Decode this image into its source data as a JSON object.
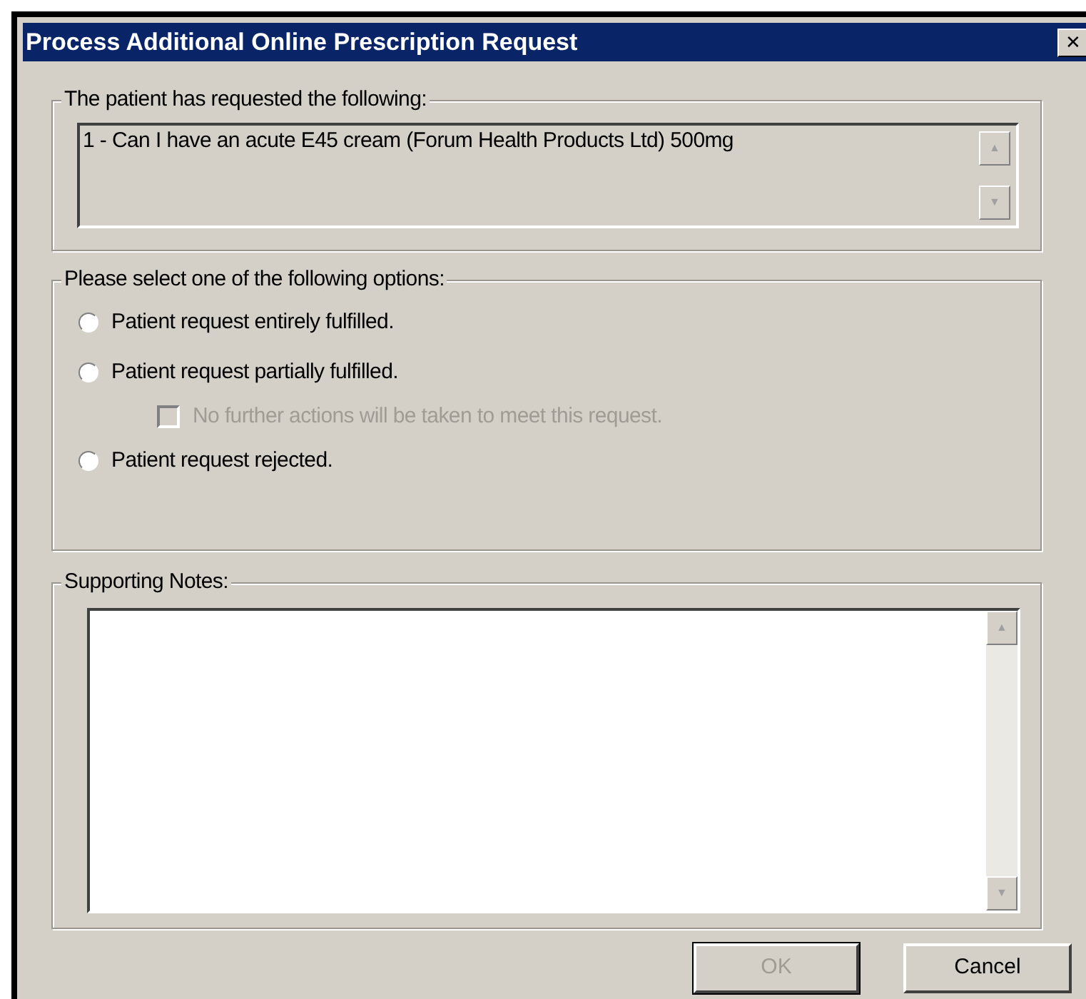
{
  "window": {
    "title": "Process Additional Online Prescription Request",
    "close": "✕"
  },
  "request_group": {
    "legend": "The patient has requested the following:",
    "text": "1 - Can I have an acute E45 cream (Forum Health Products Ltd) 500mg",
    "scroll_up": "▲",
    "scroll_down": "▼"
  },
  "options_group": {
    "legend": "Please select one of the following options:",
    "options": [
      {
        "kind": "radio",
        "label": "Patient request entirely fulfilled.",
        "selected": false,
        "disabled": false
      },
      {
        "kind": "radio",
        "label": "Patient request partially fulfilled.",
        "selected": false,
        "disabled": false
      },
      {
        "kind": "checkbox",
        "label": "No further actions will be taken to meet this request.",
        "checked": false,
        "disabled": true
      },
      {
        "kind": "radio",
        "label": "Patient request rejected.",
        "selected": false,
        "disabled": false
      }
    ]
  },
  "notes_group": {
    "legend": "Supporting Notes:",
    "scroll_up": "▲",
    "scroll_down": "▼"
  },
  "buttons": [
    {
      "label": "OK",
      "disabled": true
    },
    {
      "label": "Cancel",
      "disabled": false
    }
  ]
}
